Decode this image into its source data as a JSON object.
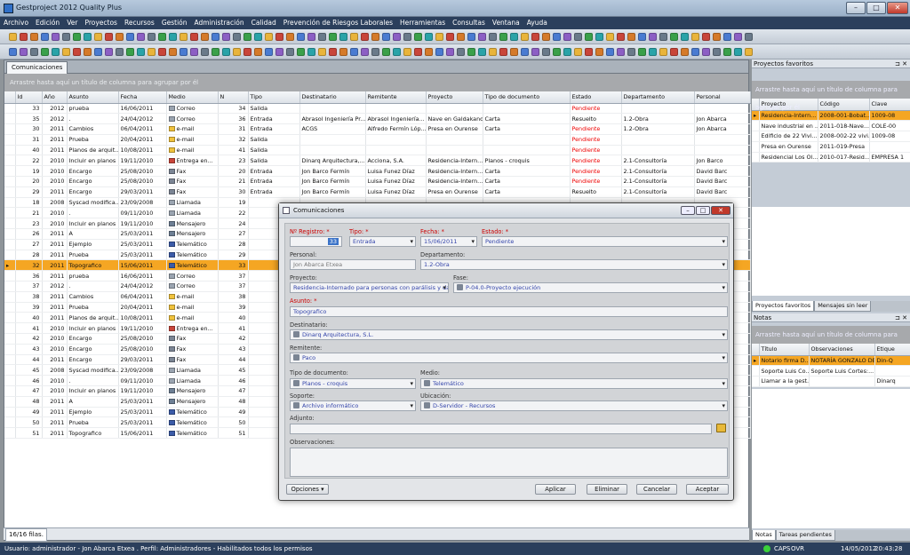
{
  "window": {
    "title": "Gestproject 2012 Quality Plus"
  },
  "menu": [
    "Archivo",
    "Edición",
    "Ver",
    "Proyectos",
    "Recursos",
    "Gestión",
    "Administración",
    "Calidad",
    "Prevención de Riesgos Laborales",
    "Herramientas",
    "Consultas",
    "Ventana",
    "Ayuda"
  ],
  "main": {
    "tab": "Comunicaciones",
    "group_hint": "Arrastre hasta aquí un título de columna para agrupar por él",
    "columns": [
      "Id",
      "Año",
      "Asunto",
      "Fecha",
      "Medio",
      "N",
      "Tipo",
      "Destinatario",
      "Remitente",
      "Proyecto",
      "Tipo de documento",
      "Estado",
      "Departamento",
      "Personal"
    ],
    "rows": [
      [
        "33",
        "2012",
        "prueba",
        "16/06/2011",
        "Correo",
        "34",
        "Salida",
        "",
        "",
        "",
        "",
        "Pendiente",
        "",
        ""
      ],
      [
        "35",
        "2012",
        ".",
        "24/04/2012",
        "Correo",
        "36",
        "Entrada",
        "Abrasol Ingeniería Pr...",
        "Abrasol Ingeniería...",
        "Nave en Galdakano",
        "Carta",
        "Resuelto",
        "1.2-Obra",
        "Jon Abarca"
      ],
      [
        "30",
        "2011",
        "Cambios",
        "06/04/2011",
        "e-mail",
        "31",
        "Entrada",
        "ACGS",
        "Alfredo Fermín Lóp...",
        "Presa en Ourense",
        "Carta",
        "Pendiente",
        "1.2-Obra",
        "Jon Abarca"
      ],
      [
        "31",
        "2011",
        "Prueba",
        "20/04/2011",
        "e-mail",
        "32",
        "Salida",
        "",
        "",
        "",
        "",
        "Pendiente",
        "",
        ""
      ],
      [
        "40",
        "2011",
        "Planos de arquit...",
        "10/08/2011",
        "e-mail",
        "41",
        "Salida",
        "",
        "",
        "",
        "",
        "Pendiente",
        "",
        ""
      ],
      [
        "22",
        "2010",
        "Incluir en planos",
        "19/11/2010",
        "Entrega en...",
        "23",
        "Salida",
        "Dinarq Arquitectura,...",
        "Acciona, S.A.",
        "Residencia-Intern...",
        "Planos - croquis",
        "Pendiente",
        "2.1-Consultoría",
        "Jon Barco"
      ],
      [
        "19",
        "2010",
        "Encargo",
        "25/08/2010",
        "Fax",
        "20",
        "Entrada",
        "Jon Barco Fermín",
        "Luisa Funez Díaz",
        "Residencia-Intern...",
        "Carta",
        "Pendiente",
        "2.1-Consultoría",
        "David Barc"
      ],
      [
        "20",
        "2010",
        "Encargo",
        "25/08/2010",
        "Fax",
        "21",
        "Entrada",
        "Jon Barco Fermín",
        "Luisa Funez Díaz",
        "Residencia-Intern...",
        "Carta",
        "Pendiente",
        "2.1-Consultoría",
        "David Barc"
      ],
      [
        "29",
        "2011",
        "Encargo",
        "29/03/2011",
        "Fax",
        "30",
        "Entrada",
        "Jon Barco Fermín",
        "Luisa Funez Díaz",
        "Presa en Ourense",
        "Carta",
        "Resuelto",
        "2.1-Consultoría",
        "David Barc"
      ],
      [
        "18",
        "2008",
        "Syscad modifica...",
        "23/09/2008",
        "Llamada",
        "19",
        "",
        "",
        "",
        "",
        "",
        "",
        "",
        ""
      ],
      [
        "21",
        "2010",
        ".",
        "09/11/2010",
        "Llamada",
        "22",
        "",
        "",
        "",
        "",
        "",
        "",
        "",
        ""
      ],
      [
        "23",
        "2010",
        "Incluir en planos",
        "19/11/2010",
        "Mensajero",
        "24",
        "",
        "",
        "",
        "",
        "",
        "",
        "",
        ""
      ],
      [
        "26",
        "2011",
        "A",
        "25/03/2011",
        "Mensajero",
        "27",
        "",
        "",
        "",
        "",
        "",
        "",
        "",
        ""
      ],
      [
        "27",
        "2011",
        "Ejemplo",
        "25/03/2011",
        "Telemático",
        "28",
        "",
        "",
        "",
        "",
        "",
        "",
        "",
        ""
      ],
      [
        "28",
        "2011",
        "Prueba",
        "25/03/2011",
        "Telemático",
        "29",
        "",
        "",
        "",
        "",
        "",
        "",
        "",
        ""
      ],
      [
        "32",
        "2011",
        "Topografico",
        "15/06/2011",
        "Telemático",
        "33",
        "",
        "",
        "",
        "",
        "",
        "",
        "",
        "Jon Barc"
      ],
      [
        "36",
        "2011",
        "prueba",
        "16/06/2011",
        "Correo",
        "37",
        "",
        "",
        "",
        "",
        "",
        "",
        "",
        ""
      ],
      [
        "37",
        "2012",
        ".",
        "24/04/2012",
        "Correo",
        "37",
        "",
        "",
        "",
        "",
        "",
        "",
        "",
        ""
      ],
      [
        "38",
        "2011",
        "Cambios",
        "06/04/2011",
        "e-mail",
        "38",
        "",
        "",
        "",
        "",
        "",
        "",
        "",
        ""
      ],
      [
        "39",
        "2011",
        "Prueba",
        "20/04/2011",
        "e-mail",
        "39",
        "",
        "",
        "",
        "",
        "",
        "",
        "",
        ""
      ],
      [
        "40",
        "2011",
        "Planos de arquit...",
        "10/08/2011",
        "e-mail",
        "40",
        "",
        "",
        "",
        "",
        "",
        "",
        "",
        ""
      ],
      [
        "41",
        "2010",
        "Incluir en planos",
        "19/11/2010",
        "Entrega en...",
        "41",
        "",
        "",
        "",
        "",
        "",
        "",
        "",
        ""
      ],
      [
        "42",
        "2010",
        "Encargo",
        "25/08/2010",
        "Fax",
        "42",
        "",
        "",
        "",
        "",
        "",
        "",
        "",
        ""
      ],
      [
        "43",
        "2010",
        "Encargo",
        "25/08/2010",
        "Fax",
        "43",
        "",
        "",
        "",
        "",
        "",
        "",
        "",
        ""
      ],
      [
        "44",
        "2011",
        "Encargo",
        "29/03/2011",
        "Fax",
        "44",
        "",
        "",
        "",
        "",
        "",
        "",
        "",
        ""
      ],
      [
        "45",
        "2008",
        "Syscad modifica...",
        "23/09/2008",
        "Llamada",
        "45",
        "",
        "",
        "",
        "",
        "",
        "",
        "",
        ""
      ],
      [
        "46",
        "2010",
        ".",
        "09/11/2010",
        "Llamada",
        "46",
        "",
        "",
        "",
        "",
        "",
        "",
        "",
        ""
      ],
      [
        "47",
        "2010",
        "Incluir en planos",
        "19/11/2010",
        "Mensajero",
        "47",
        "",
        "",
        "",
        "",
        "",
        "",
        "",
        ""
      ],
      [
        "48",
        "2011",
        "A",
        "25/03/2011",
        "Mensajero",
        "48",
        "",
        "",
        "",
        "",
        "",
        "",
        "",
        ""
      ],
      [
        "49",
        "2011",
        "Ejemplo",
        "25/03/2011",
        "Telemático",
        "49",
        "",
        "",
        "",
        "",
        "",
        "",
        "",
        ""
      ],
      [
        "50",
        "2011",
        "Prueba",
        "25/03/2011",
        "Telemático",
        "50",
        "",
        "",
        "",
        "",
        "",
        "",
        "",
        ""
      ],
      [
        "51",
        "2011",
        "Topografico",
        "15/06/2011",
        "Telemático",
        "51",
        "",
        "",
        "",
        "",
        "",
        "",
        "",
        ""
      ]
    ],
    "selected_row": 15,
    "record_count": "16/16 filas."
  },
  "statusbar": {
    "left": "Usuario: administrador - Jon Abarca Etxea . Perfil: Administradores - Habilitados todos los permisos",
    "caps": "CAPS",
    "ovr": "OVR",
    "date": "14/05/2012",
    "time": "20:43:28"
  },
  "favorites": {
    "title": "Proyectos favoritos",
    "group_hint": "Arrastre hasta aquí un título de columna para agrupar por él",
    "columns": [
      "Proyecto",
      "Código",
      "Clave"
    ],
    "rows": [
      [
        "Residencia-Intern...",
        "2008-001-Bobat...",
        "1009-08"
      ],
      [
        "Nave industrial en ...",
        "2011-018-Nave...",
        "COLE-00"
      ],
      [
        "Edificio de 22 Vivi...",
        "2008-002-22 vivi...",
        "1009-08"
      ],
      [
        "Presa en Ourense",
        "2011-019-Presa",
        ""
      ],
      [
        "Residencial Los Ol...",
        "2010-017-Resid...",
        "EMPRESA 1"
      ]
    ],
    "tabs": [
      "Proyectos favoritos",
      "Mensajes sin leer"
    ]
  },
  "notes": {
    "title": "Notas",
    "group_hint": "Arrastre hasta aquí un título de columna para agrupar por él",
    "columns": [
      "Título",
      "Observaciones",
      "Etique"
    ],
    "rows": [
      [
        "Notario firma D...",
        "NOTARÍA GONZALO DE...",
        "Din-Q"
      ],
      [
        "Soporte Luis Co...",
        "Soporte Luis Cortes:...",
        ""
      ],
      [
        "Llamar a la gest...",
        "",
        "Dinarq"
      ]
    ],
    "tabs": [
      "Notas",
      "Tareas pendientes"
    ]
  },
  "dialog": {
    "title": "Comunicaciones",
    "labels": {
      "nregistro": "Nº Registro: *",
      "tipo": "Tipo: *",
      "fecha": "Fecha: *",
      "estado": "Estado: *",
      "personal": "Personal:",
      "departamento": "Departamento:",
      "proyecto": "Proyecto:",
      "fase": "Fase:",
      "asunto": "Asunto: *",
      "destinatario": "Destinatario:",
      "remitente": "Remitente:",
      "tipodoc": "Tipo de documento:",
      "medio": "Medio:",
      "soporte": "Soporte:",
      "ubicacion": "Ubicación:",
      "adjunto": "Adjunto:",
      "observaciones": "Observaciones:"
    },
    "values": {
      "nregistro": "33",
      "tipo": "Entrada",
      "fecha": "15/06/2011",
      "estado": "Pendiente",
      "personal": "Jon Abarca Etxea",
      "departamento": "1.2-Obra",
      "proyecto": "Residencia-Internado para personas con parálisis y daño",
      "fase": "P-04.0-Proyecto ejecución",
      "asunto": "Topografico",
      "destinatario": "Dinarq Arquitectura, S.L.",
      "remitente": "Paco",
      "tipodoc": "Planos - croquis",
      "medio": "Telemático",
      "soporte": "Archivo informático",
      "ubicacion": "D-Servidor - Recursos",
      "adjunto": "",
      "observaciones": ""
    },
    "buttons": {
      "opciones": "Opciones",
      "aplicar": "Aplicar",
      "eliminar": "Eliminar",
      "cancelar": "Cancelar",
      "aceptar": "Aceptar"
    }
  }
}
